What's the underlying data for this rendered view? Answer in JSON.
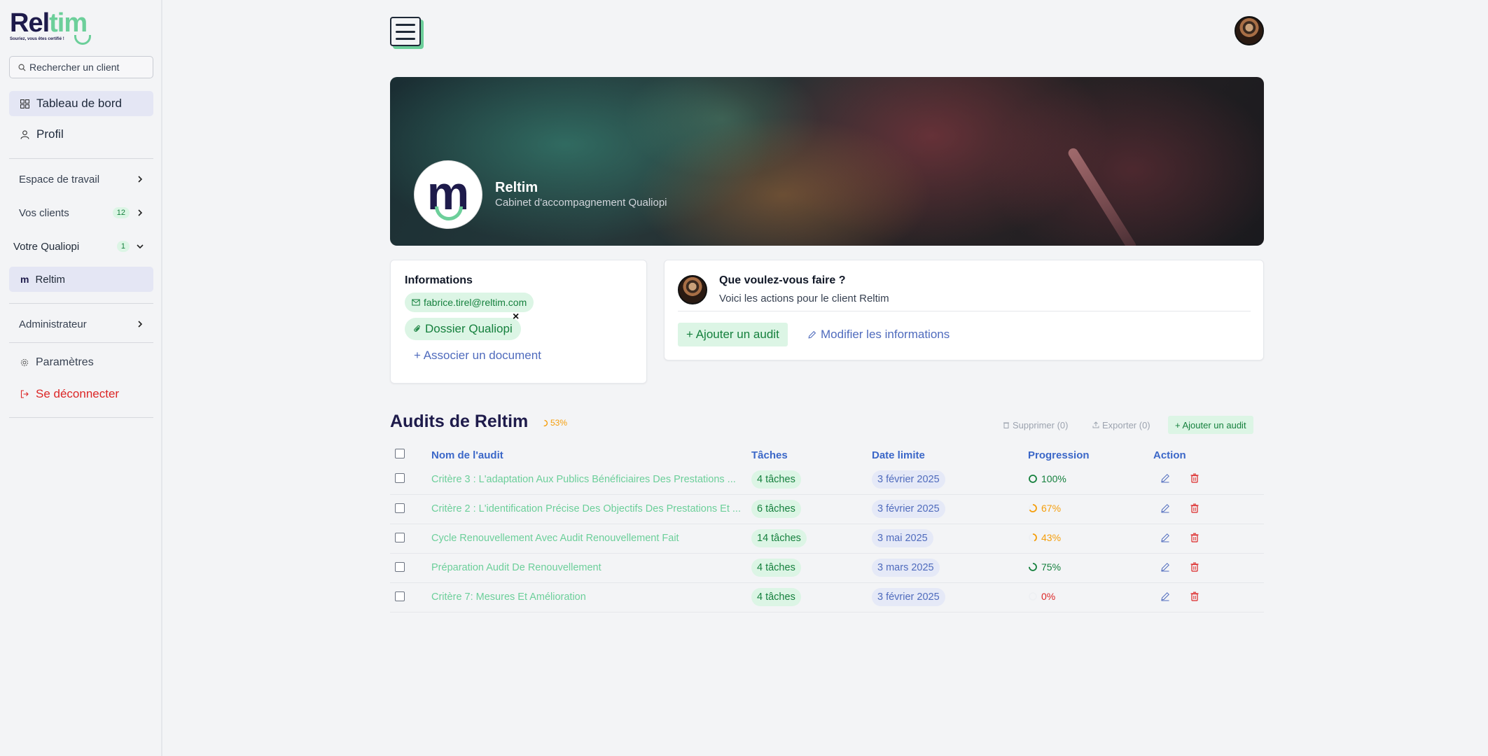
{
  "sidebar": {
    "logo_a": "Rel",
    "logo_b": "tim",
    "logo_tagline": "Souriez, vous êtes certifié !",
    "search_placeholder": "Rechercher un client",
    "dashboard": "Tableau de bord",
    "profile": "Profil",
    "workspace": "Espace de travail",
    "clients": "Vos clients",
    "clients_count": "12",
    "qualiopi": "Votre Qualiopi",
    "qualiopi_count": "1",
    "qualiopi_item": "Reltim",
    "admin": "Administrateur",
    "settings": "Paramètres",
    "logout": "Se déconnecter"
  },
  "org": {
    "name": "Reltim",
    "subtitle": "Cabinet d'accompagnement Qualiopi"
  },
  "info": {
    "title": "Informations",
    "email": "fabrice.tirel@reltim.com",
    "file": "Dossier Qualiopi",
    "remove": "×",
    "add_doc": "+ Associer un document"
  },
  "actions": {
    "title": "Que voulez-vous faire ?",
    "subtitle": "Voici les actions pour le client Reltim",
    "add_audit": "+ Ajouter un audit",
    "edit_info": "Modifier les informations"
  },
  "audits": {
    "title": "Audits de Reltim",
    "overall": "53%",
    "overall_value": 0.53,
    "delete": "Supprimer (0)",
    "export": "Exporter (0)",
    "add": "+ Ajouter un audit",
    "columns": [
      "Nom de l'audit",
      "Tâches",
      "Date limite",
      "Progression",
      "Action"
    ],
    "rows": [
      {
        "name": "Critère 3 : L'adaptation Aux Publics Bénéficiaires Des Prestations ...",
        "tasks": "4 tâches",
        "date": "3 février 2025",
        "progress": "100%",
        "value": 1.0,
        "color": "#15803d"
      },
      {
        "name": "Critère 2 : L'identification Précise Des Objectifs Des Prestations Et ...",
        "tasks": "6 tâches",
        "date": "3 février 2025",
        "progress": "67%",
        "value": 0.67,
        "color": "#f59e0b"
      },
      {
        "name": "Cycle Renouvellement Avec Audit Renouvellement Fait",
        "tasks": "14 tâches",
        "date": "3 mai 2025",
        "progress": "43%",
        "value": 0.43,
        "color": "#f59e0b"
      },
      {
        "name": "Préparation Audit De Renouvellement",
        "tasks": "4 tâches",
        "date": "3 mars 2025",
        "progress": "75%",
        "value": 0.75,
        "color": "#15803d"
      },
      {
        "name": "Critère 7: Mesures Et Amélioration",
        "tasks": "4 tâches",
        "date": "3 février 2025",
        "progress": "0%",
        "value": 0.0,
        "color": "#dc2626"
      }
    ]
  },
  "colors": {
    "brand_navy": "#1e1b4b",
    "brand_green": "#6ccf9a",
    "link_blue": "#4f6bbd",
    "danger": "#dc2626"
  }
}
